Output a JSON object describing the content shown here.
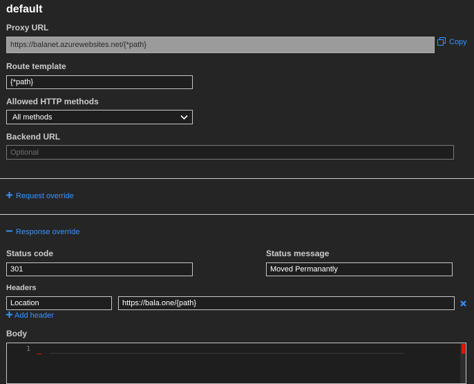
{
  "page": {
    "title": "default"
  },
  "proxy_url": {
    "label": "Proxy URL",
    "value": "https://balanet.azurewebsites.net/{*path}",
    "copy_label": "Copy"
  },
  "route_template": {
    "label": "Route template",
    "value": "{*path}"
  },
  "http_methods": {
    "label": "Allowed HTTP methods",
    "selected": "All methods"
  },
  "backend_url": {
    "label": "Backend URL",
    "placeholder": "Optional",
    "value": ""
  },
  "request_override": {
    "label": "Request override",
    "icon": "plus-icon"
  },
  "response_override": {
    "label": "Response override",
    "icon": "minus-icon",
    "status_code": {
      "label": "Status code",
      "value": "301"
    },
    "status_message": {
      "label": "Status message",
      "value": "Moved Permanantly"
    },
    "headers": {
      "label": "Headers",
      "items": [
        {
          "name": "Location",
          "value": "https://bala.one/{path}"
        }
      ],
      "add_label": "Add header"
    },
    "body": {
      "label": "Body",
      "line_number": "1"
    }
  },
  "colors": {
    "accent": "#3794ff",
    "background": "#252526",
    "error": "#e51400"
  }
}
